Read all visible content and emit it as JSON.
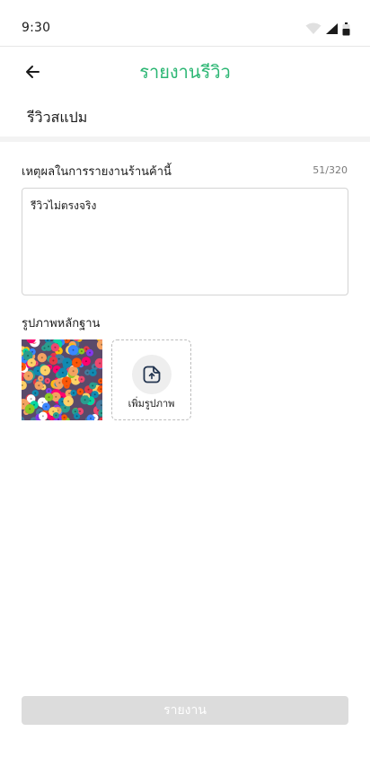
{
  "status_bar": {
    "time": "9:30",
    "icons": [
      "wifi-icon",
      "signal-icon",
      "battery-icon"
    ]
  },
  "header": {
    "back_icon": "arrow-left-icon",
    "title": "รายงานรีวิว",
    "title_color": "#2bb673"
  },
  "subject": {
    "text": "รีวิวสแปม"
  },
  "reason": {
    "label": "เหตุผลในการรายงานร้านค้านี้",
    "counter": "51/320",
    "value": "รีวิวไม่ตรงจริง"
  },
  "evidence": {
    "label": "รูปภาพหลักฐาน",
    "image_icon": "colorful-beads-photo",
    "add_icon": "upload-file-icon",
    "add_label": "เพิ่มรูปภาพ"
  },
  "submit": {
    "label": "รายงาน",
    "state": "disabled"
  }
}
